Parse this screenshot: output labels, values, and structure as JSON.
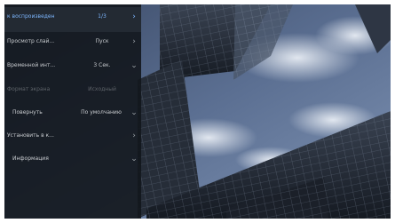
{
  "colors": {
    "accent": "#7db7ff",
    "text": "#c9ccd0",
    "disabled": "#5d6268",
    "panel": "#12161c"
  },
  "menu": {
    "items": [
      {
        "label": "к воспроизведен",
        "value": "1/3",
        "icon": "chevron-right-icon",
        "selected": true
      },
      {
        "label": "Просмотр слай...",
        "value": "Пуск",
        "icon": "chevron-right-icon"
      },
      {
        "label": "Временной инт...",
        "value": "3 Сек.",
        "icon": "chevron-down-icon"
      },
      {
        "label": "Формат экрана",
        "value": "Исходный",
        "disabled": true
      },
      {
        "label": "Повернуть",
        "value": "По умолчанию",
        "icon": "chevron-down-icon"
      },
      {
        "label": "Установить в к...",
        "value": "",
        "icon": "chevron-right-icon"
      },
      {
        "label": "Информация",
        "value": "",
        "icon": "chevron-down-icon"
      }
    ]
  }
}
